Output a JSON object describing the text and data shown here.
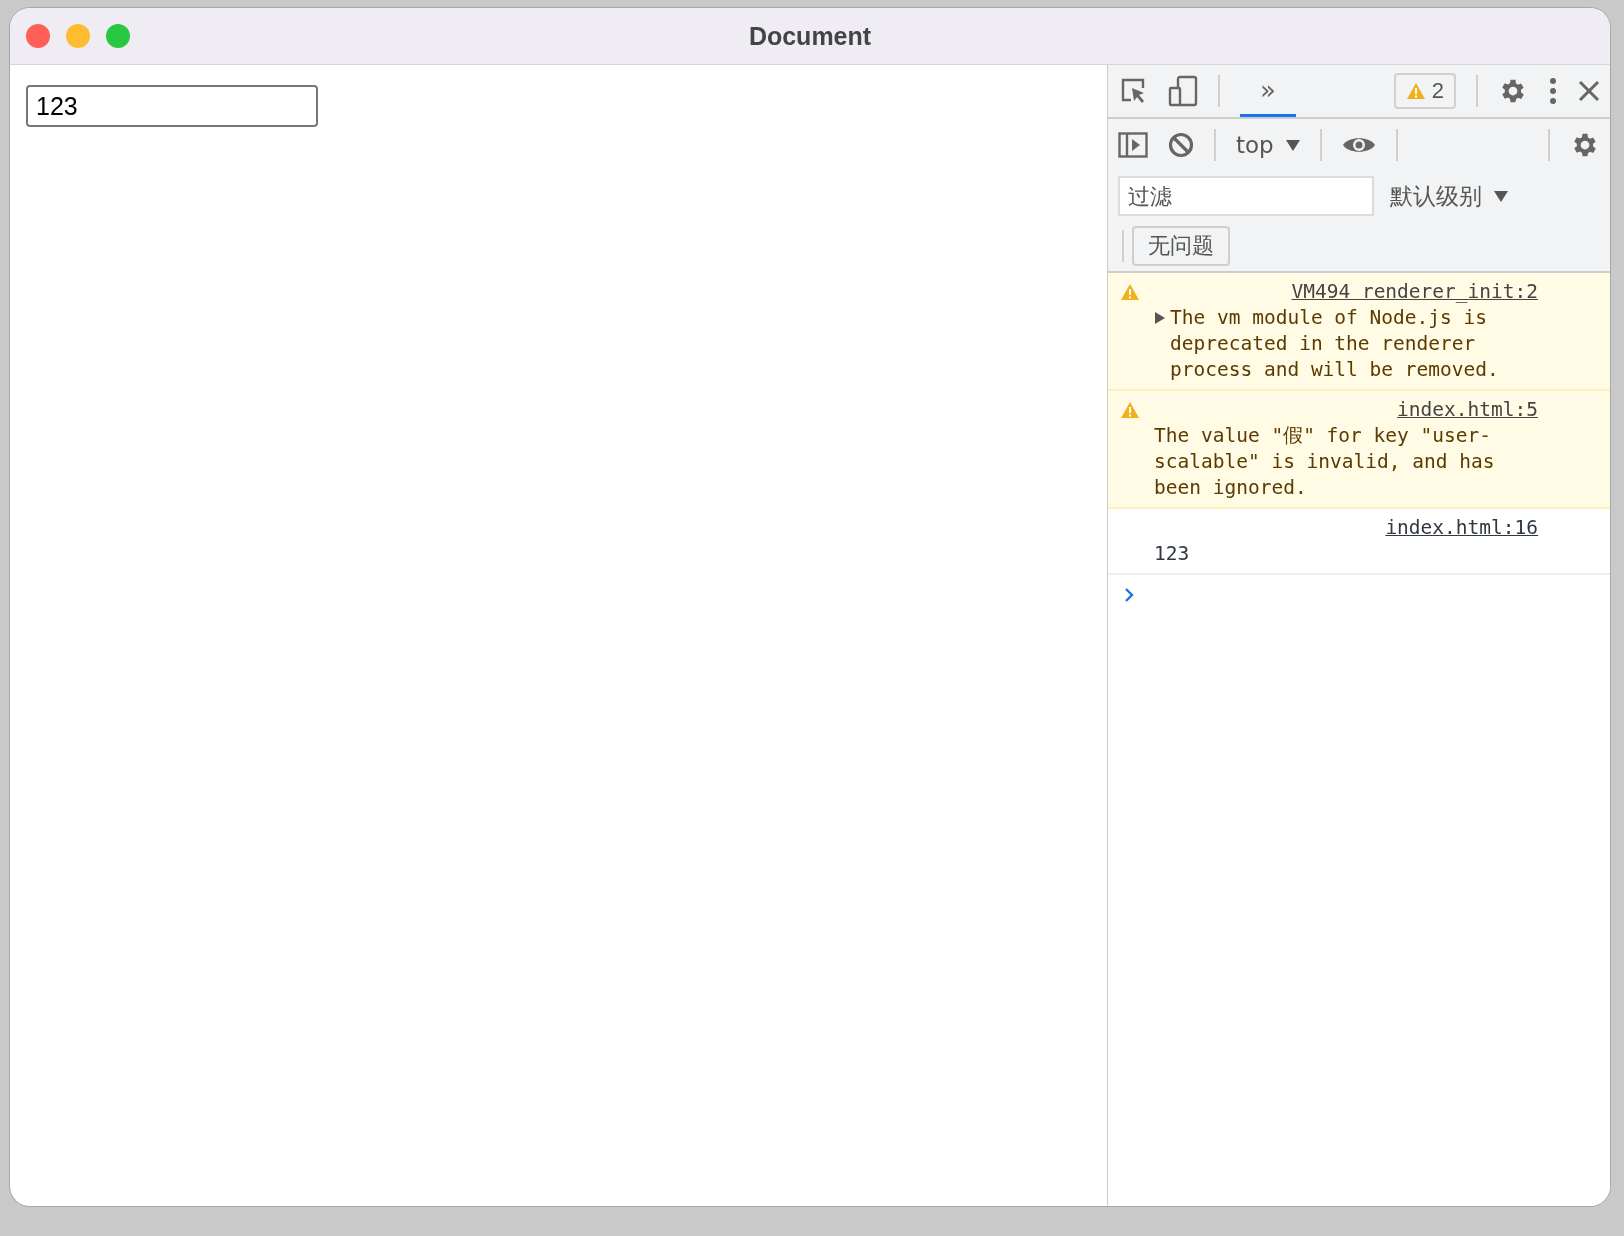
{
  "window": {
    "title": "Document"
  },
  "page": {
    "input": {
      "value": "123"
    }
  },
  "devtools": {
    "tabs": [
      {
        "label": "»",
        "selected": true
      }
    ],
    "issues_badge": {
      "count": "2"
    },
    "console_toolbar": {
      "context": "top",
      "filter": {
        "placeholder": "过滤"
      },
      "level": "默认级别",
      "issues_button": "无问题"
    },
    "messages": [
      {
        "kind": "warning",
        "expanded": false,
        "text": "The vm module of Node.js is deprecated in the renderer process and will be removed.",
        "source": "VM494 renderer_init:2"
      },
      {
        "kind": "warning",
        "text": "The value \"假\" for key \"user-scalable\" is invalid, and has been ignored.",
        "source": "index.html:5"
      },
      {
        "kind": "log",
        "text": "123",
        "source": "index.html:16"
      }
    ]
  }
}
